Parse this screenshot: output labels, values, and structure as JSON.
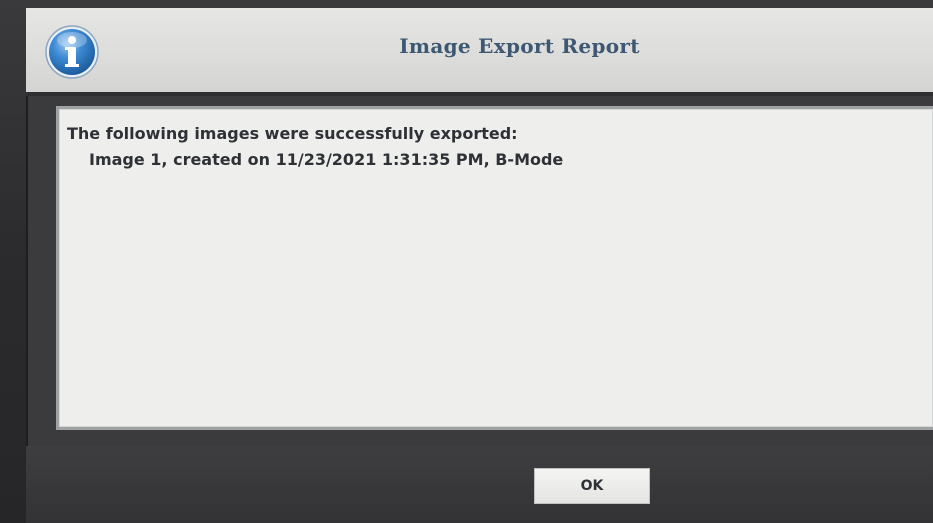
{
  "dialog": {
    "title": "Image Export Report",
    "icon": "info-icon",
    "message": {
      "heading": "The following images were successfully exported:",
      "items": [
        "Image 1, created on 11/23/2021 1:31:35 PM, B-Mode"
      ]
    },
    "ok_label": "OK"
  },
  "colors": {
    "title_text": "#3e5873",
    "title_bar": "#dcdcda",
    "frame": "#3b3b3d",
    "panel": "#eeeeec",
    "icon_blue": "#2f7fc8"
  }
}
